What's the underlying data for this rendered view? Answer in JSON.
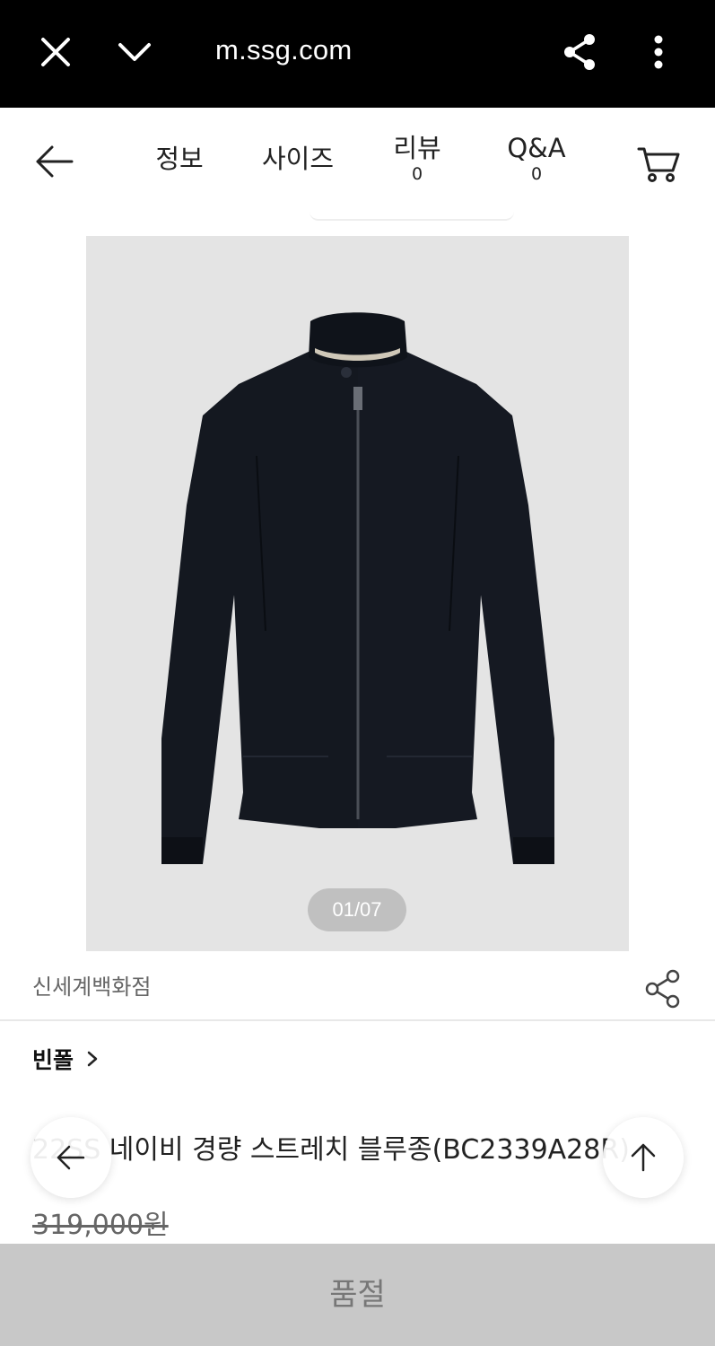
{
  "browser": {
    "url": "m.ssg.com",
    "close_icon": "close-icon",
    "chevron_icon": "chevron-down-icon",
    "share_icon": "share-icon",
    "more_icon": "more-vertical-icon"
  },
  "tabs": {
    "info": "정보",
    "size": "사이즈",
    "review_label": "리뷰",
    "review_count": "0",
    "qa_label": "Q&A",
    "qa_count": "0"
  },
  "image": {
    "counter": "01/07"
  },
  "store": {
    "name": "신세계백화점"
  },
  "product": {
    "brand": "빈폴",
    "title": "22SS 네이비 경량 스트레치 블루종(BC2339A28R)",
    "price": "319,000원"
  },
  "action": {
    "sold_out": "품절"
  },
  "colors": {
    "browser_bar": "#000000",
    "image_bg": "#e4e4e4",
    "jacket": "#141820",
    "soldout_bar": "#c8c8c8"
  }
}
